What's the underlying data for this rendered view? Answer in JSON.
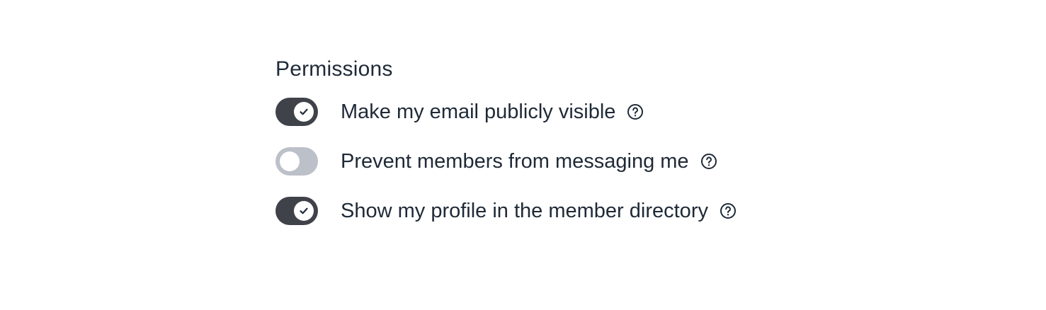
{
  "permissions": {
    "title": "Permissions",
    "items": [
      {
        "label": "Make my email publicly visible",
        "enabled": true,
        "icon": "help-circle-icon"
      },
      {
        "label": "Prevent members from messaging me",
        "enabled": false,
        "icon": "help-circle-icon"
      },
      {
        "label": "Show my profile in the member directory",
        "enabled": true,
        "icon": "help-circle-icon"
      }
    ]
  },
  "colors": {
    "toggle_on": "#3f4249",
    "toggle_off": "#bcc0c8",
    "text": "#1f2a37"
  }
}
